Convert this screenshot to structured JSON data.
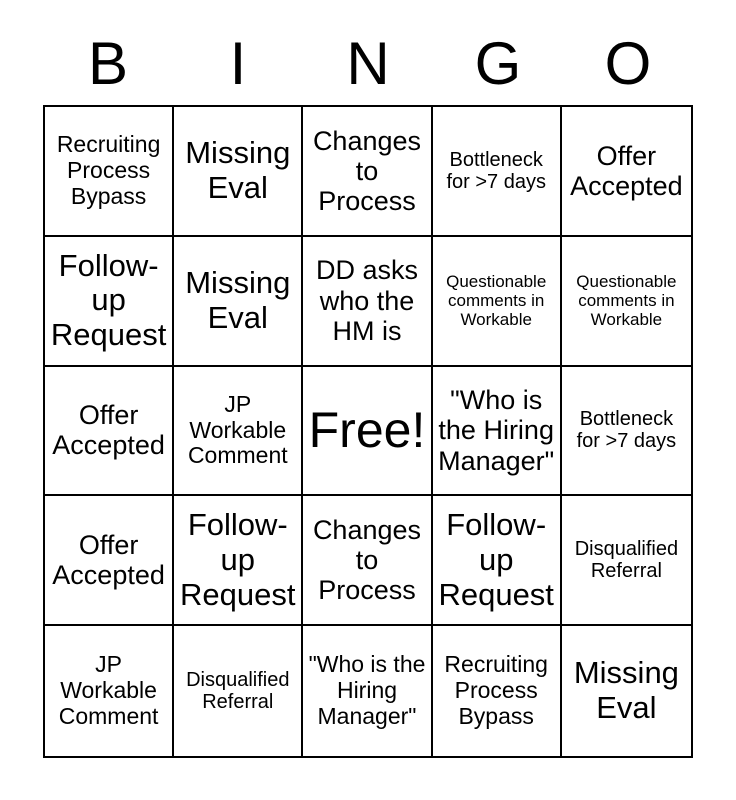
{
  "card": {
    "title": "BINGO",
    "free_space_label": "Free!",
    "header_letters": [
      "B",
      "I",
      "N",
      "G",
      "O"
    ],
    "grid_size": 5,
    "colors": {
      "background": "#ffffff",
      "border": "#000000",
      "text": "#000000"
    }
  },
  "rows": [
    {
      "cells": [
        {
          "text": "Recruiting Process Bypass",
          "size": "fs-m"
        },
        {
          "text": "Missing Eval",
          "size": "fs-xl"
        },
        {
          "text": "Changes to Process",
          "size": "fs-l"
        },
        {
          "text": "Bottleneck for >7 days",
          "size": "fs-s"
        },
        {
          "text": "Offer Accepted",
          "size": "fs-l"
        }
      ]
    },
    {
      "cells": [
        {
          "text": "Follow-up Request",
          "size": "fs-xl"
        },
        {
          "text": "Missing Eval",
          "size": "fs-xl"
        },
        {
          "text": "DD asks who the HM is",
          "size": "fs-l"
        },
        {
          "text": "Questionable comments in Workable",
          "size": "fs-xs"
        },
        {
          "text": "Questionable comments in Workable",
          "size": "fs-xs"
        }
      ]
    },
    {
      "cells": [
        {
          "text": "Offer Accepted",
          "size": "fs-l"
        },
        {
          "text": "JP Workable Comment",
          "size": "fs-m"
        },
        {
          "text": "Free!",
          "size": "fs-free"
        },
        {
          "text": "\"Who is the Hiring Manager\"",
          "size": "fs-l"
        },
        {
          "text": "Bottleneck for >7 days",
          "size": "fs-s"
        }
      ]
    },
    {
      "cells": [
        {
          "text": "Offer Accepted",
          "size": "fs-l"
        },
        {
          "text": "Follow-up Request",
          "size": "fs-xl"
        },
        {
          "text": "Changes to Process",
          "size": "fs-l"
        },
        {
          "text": "Follow-up Request",
          "size": "fs-xl"
        },
        {
          "text": "Disqualified Referral",
          "size": "fs-s"
        }
      ]
    },
    {
      "cells": [
        {
          "text": "JP Workable Comment",
          "size": "fs-m"
        },
        {
          "text": "Disqualified Referral",
          "size": "fs-s"
        },
        {
          "text": "\"Who is the Hiring Manager\"",
          "size": "fs-m"
        },
        {
          "text": "Recruiting Process Bypass",
          "size": "fs-m"
        },
        {
          "text": "Missing Eval",
          "size": "fs-xl"
        }
      ]
    }
  ]
}
